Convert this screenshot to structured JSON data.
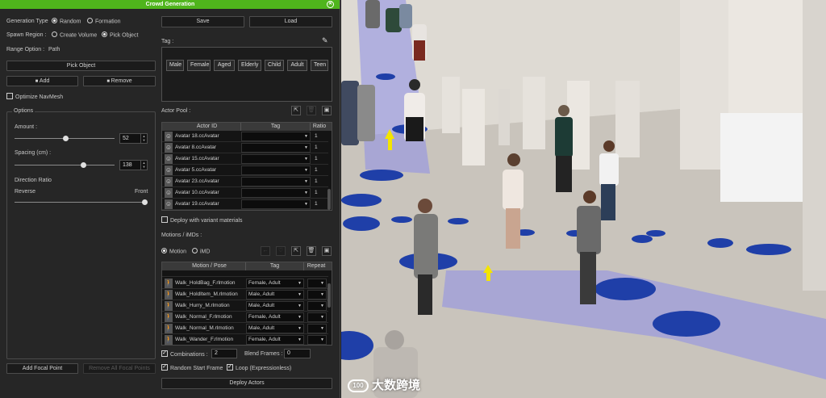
{
  "panel": {
    "title": "Crowd Generation",
    "generation_type_label": "Generation Type",
    "generation_type_options": [
      "Random",
      "Formation"
    ],
    "spawn_region_label": "Spawn Region :",
    "spawn_region_options": [
      "Create Volume",
      "Pick Object"
    ],
    "range_option_label": "Range Option :",
    "range_option_value": "Path",
    "pick_object_button": "Pick Object",
    "add_button": "Add",
    "remove_button": "Remove",
    "optimize_navmesh_label": "Optimize NavMesh",
    "options_group_label": "Options",
    "amount_label": "Amount :",
    "amount_value": "52",
    "spacing_label": "Spacing (cm) :",
    "spacing_value": "138",
    "direction_ratio_label": "Direction Ratio",
    "reverse_label": "Reverse",
    "front_label": "Front",
    "add_focal_point_button": "Add Focal Point",
    "remove_focal_points_button": "Remove All Focal Points",
    "save_button": "Save",
    "load_button": "Load",
    "tag_label": "Tag :",
    "tags": [
      "Male",
      "Female",
      "Aged",
      "Elderly",
      "Child",
      "Adult",
      "Teen"
    ],
    "actor_pool_label": "Actor Pool :",
    "actor_table": {
      "headers": [
        "Actor ID",
        "Tag",
        "Ratio"
      ],
      "rows": [
        {
          "id": "Avatar 18.ccAvatar",
          "tag": "",
          "ratio": "1"
        },
        {
          "id": "Avatar 8.ccAvatar",
          "tag": "",
          "ratio": "1"
        },
        {
          "id": "Avatar 15.ccAvatar",
          "tag": "",
          "ratio": "1"
        },
        {
          "id": "Avatar 5.ccAvatar",
          "tag": "",
          "ratio": "1"
        },
        {
          "id": "Avatar 23.ccAvatar",
          "tag": "",
          "ratio": "1"
        },
        {
          "id": "Avatar 10.ccAvatar",
          "tag": "",
          "ratio": "1"
        },
        {
          "id": "Avatar 19.ccAvatar",
          "tag": "",
          "ratio": "1"
        }
      ]
    },
    "deploy_variant_label": "Deploy with variant materials",
    "motions_label": "Motions / iMDs :",
    "motion_type_options": [
      "Motion",
      "iMD"
    ],
    "motion_table": {
      "headers": [
        "Motion / Pose",
        "Tag",
        "Repeat"
      ],
      "rows": [
        {
          "id": "Walk_HoldBag_F.rlmotion",
          "tag": "Female, Adult"
        },
        {
          "id": "Walk_HoldItem_M.rlmotion",
          "tag": "Male, Adult"
        },
        {
          "id": "Walk_Hurry_M.rlmotion",
          "tag": "Male, Adult"
        },
        {
          "id": "Walk_Normal_F.rlmotion",
          "tag": "Female, Adult"
        },
        {
          "id": "Walk_Normal_M.rlmotion",
          "tag": "Male, Adult"
        },
        {
          "id": "Walk_Wander_F.rlmotion",
          "tag": "Female, Adult"
        }
      ]
    },
    "combinations_label": "Combinations :",
    "combinations_value": "2",
    "blend_frames_label": "Blend Frames :",
    "blend_frames_value": "0",
    "random_start_label": "Random Start Frame",
    "loop_label": "Loop (Expressionless)",
    "deploy_actors_button": "Deploy Actors"
  },
  "watermark": {
    "logo": "100",
    "text": "大数跨境"
  },
  "colors": {
    "title_bar": "#4fb51c",
    "path_strip": "#8c8ee8",
    "marker": "#1f3fa8"
  }
}
